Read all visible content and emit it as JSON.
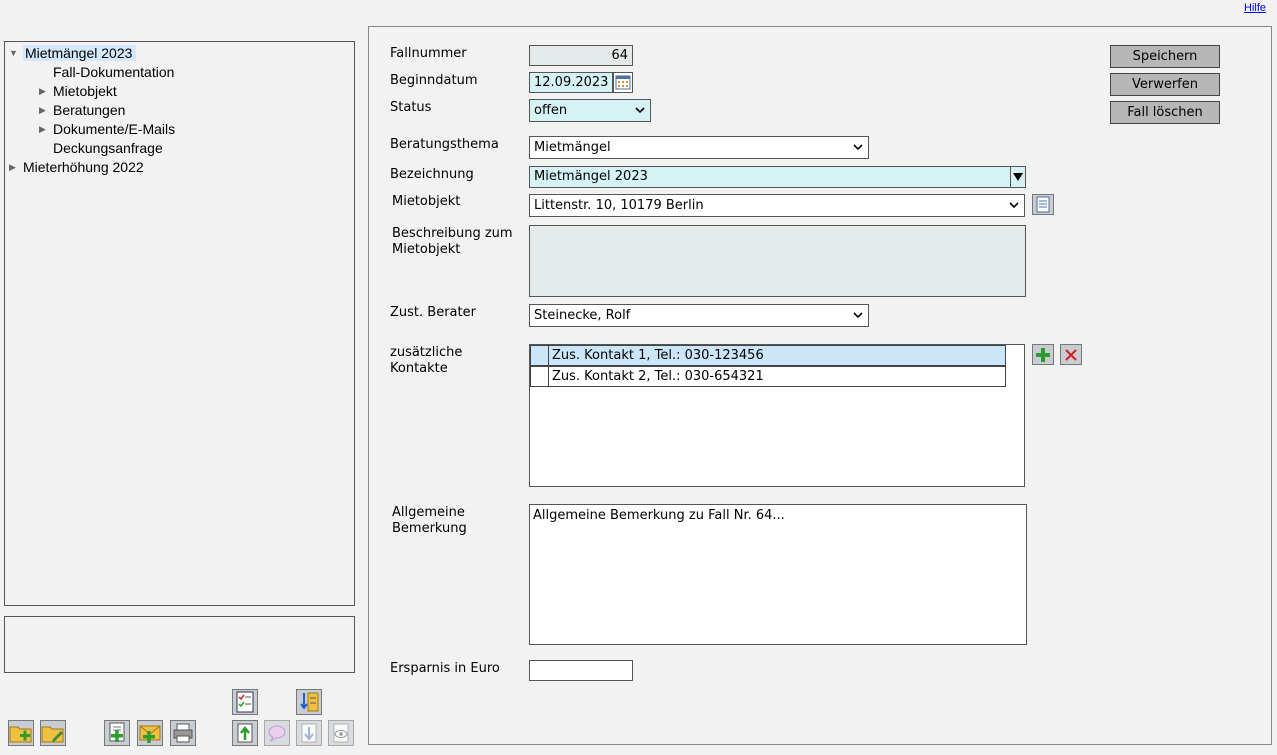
{
  "header": {
    "help_link": "Hilfe"
  },
  "tree": {
    "items": [
      {
        "label": "Mietmängel 2023",
        "level": 0,
        "expanded": true,
        "selected": true
      },
      {
        "label": "Fall-Dokumentation",
        "level": 1,
        "has_children": false
      },
      {
        "label": "Mietobjekt",
        "level": 1,
        "has_children": true
      },
      {
        "label": "Beratungen",
        "level": 1,
        "has_children": true
      },
      {
        "label": "Dokumente/E-Mails",
        "level": 1,
        "has_children": true
      },
      {
        "label": "Deckungsanfrage",
        "level": 1,
        "has_children": false
      },
      {
        "label": "Mieterhöhung 2022",
        "level": 0,
        "has_children": true
      }
    ]
  },
  "toolbar": {
    "icons": [
      "folder-add-icon",
      "folder-edit-icon",
      "document-add-icon",
      "envelope-add-icon",
      "print-icon",
      "checklist-icon",
      "download-sort-icon",
      "upload-icon",
      "comment-icon",
      "download-icon",
      "view-icon"
    ]
  },
  "form": {
    "fallnummer": {
      "label": "Fallnummer",
      "value": "64"
    },
    "beginndatum": {
      "label": "Beginndatum",
      "value": "12.09.2023"
    },
    "status": {
      "label": "Status",
      "value": "offen"
    },
    "beratungsthema": {
      "label": "Beratungsthema",
      "value": "Mietmängel"
    },
    "bezeichnung": {
      "label": "Bezeichnung",
      "value": "Mietmängel 2023"
    },
    "mietobjekt": {
      "label": "Mietobjekt",
      "value": "Littenstr. 10, 10179 Berlin"
    },
    "beschreibung": {
      "label_line1": "Beschreibung zum",
      "label_line2": "Mietobjekt",
      "value": ""
    },
    "berater": {
      "label": "Zust. Berater",
      "value": "Steinecke, Rolf"
    },
    "kontakte": {
      "label_line1": "zusätzliche",
      "label_line2": "Kontakte",
      "rows": [
        {
          "text": "Zus. Kontakt 1, Tel.: 030-123456",
          "selected": true
        },
        {
          "text": "Zus. Kontakt 2, Tel.: 030-654321",
          "selected": false
        }
      ]
    },
    "bemerkung": {
      "label_line1": "Allgemeine",
      "label_line2": "Bemerkung",
      "value": "Allgemeine Bemerkung zu Fall Nr. 64..."
    },
    "ersparnis": {
      "label": "Ersparnis in Euro",
      "value": ""
    }
  },
  "actions": {
    "save": "Speichern",
    "discard": "Verwerfen",
    "delete": "Fall löschen"
  },
  "colors": {
    "highlight": "#d5f3f4",
    "selection": "#cbe6f9",
    "button": "#b7b7b7",
    "add_green": "#2e9b2e",
    "remove_red": "#d62020"
  }
}
